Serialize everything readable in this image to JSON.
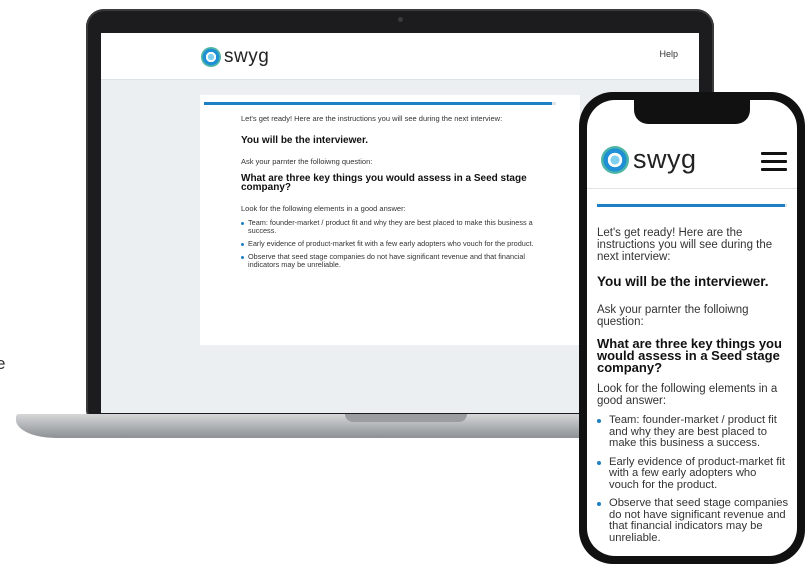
{
  "background_fragment": "e",
  "brand": {
    "name": "swyg"
  },
  "header": {
    "help_label": "Help"
  },
  "progress": {
    "value_percent": 99
  },
  "content": {
    "intro": "Let's get ready! Here are the instructions you will see during the next interview:",
    "role": "You will be the interviewer.",
    "ask": "Ask your parnter the folloiwng question:",
    "question": "What are three key things you would assess in a Seed stage company?",
    "look_for": "Look for the following elements in a good answer:",
    "elements": [
      "Team: founder-market / product fit and why they are best placed to make this business a success.",
      "Early evidence of product-market fit with a few early adopters who vouch for the product.",
      "Observe that seed stage companies do not have significant revenue and that financial indicators may be unreliable."
    ]
  },
  "colors": {
    "accent": "#1f7fc4",
    "page_bg": "#eceff2"
  },
  "icons": {
    "logo": "swyg-logo-icon",
    "menu": "hamburger-menu-icon"
  }
}
